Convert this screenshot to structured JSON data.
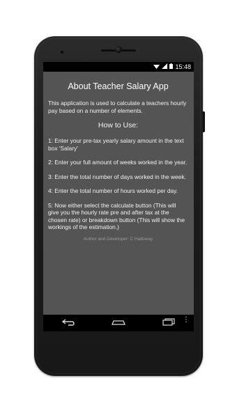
{
  "status": {
    "time": "15:48",
    "icons": [
      "wifi-icon",
      "signal-icon",
      "battery-icon"
    ]
  },
  "app": {
    "title": "About Teacher Salary App",
    "intro": "This application is used to calculate a teachers hourly pay based on a number of elements.",
    "howto_heading": "How to Use:",
    "steps": [
      "1: Enter your pre-tax yearly salary amount in the text box 'Salary'",
      "2: Enter your full amount of weeks worked in the year.",
      "3: Enter the total number of days worked in the week.",
      "4: Enter the total number of hours worked per day.",
      "5: Now either select the calculate button (This will give you the hourly rate pre and after tax at the chosen rate) or breakdown button (This will show the workings of the estimation.)"
    ],
    "footer": "Author and Developer: C Halloway"
  },
  "navbar": {
    "back_icon": "back-icon",
    "home_icon": "home-icon",
    "recents_icon": "recents-icon",
    "menu_icon": "menu-dots-icon"
  }
}
